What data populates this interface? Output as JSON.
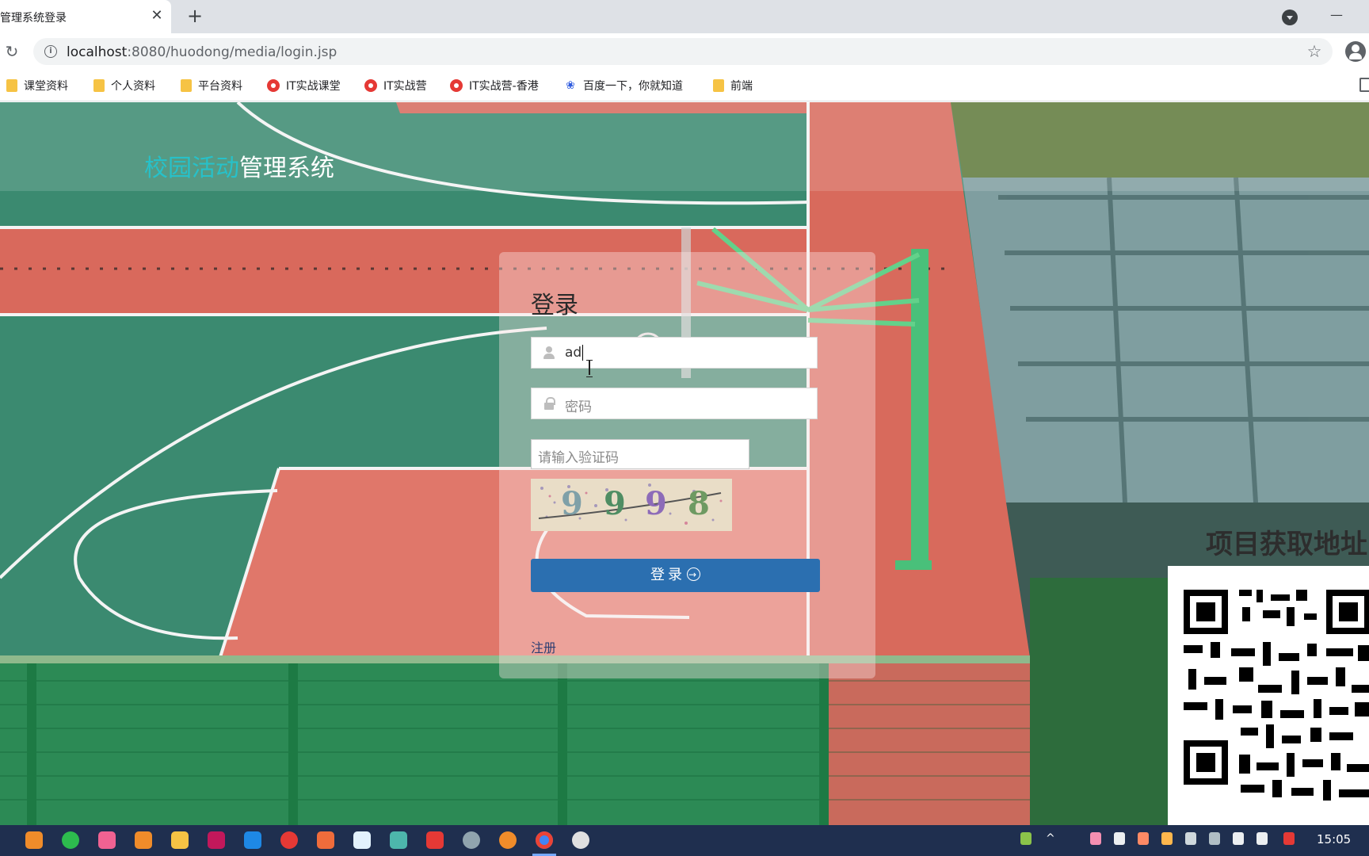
{
  "browser": {
    "tab_title": "管理系统登录",
    "tab_close": "✕",
    "new_tab": "+",
    "url_host": "localhost",
    "url_rest": ":8080/huodong/media/login.jsp",
    "reload": "↻",
    "star": "☆",
    "bookmarks": [
      {
        "label": "课堂资料",
        "icon": "folder-icon"
      },
      {
        "label": "个人资料",
        "icon": "folder-icon"
      },
      {
        "label": "平台资料",
        "icon": "folder-icon"
      },
      {
        "label": "IT实战课堂",
        "icon": "site-icon"
      },
      {
        "label": "IT实战营",
        "icon": "site-icon"
      },
      {
        "label": "IT实战营-香港",
        "icon": "site-icon"
      },
      {
        "label": "百度一下，你就知道",
        "icon": "paw-icon"
      },
      {
        "label": "前端",
        "icon": "folder-icon"
      }
    ]
  },
  "site": {
    "title_accent": "校园活动",
    "title_rest": "管理系统"
  },
  "login": {
    "heading": "登录",
    "username_value": "ad",
    "password_placeholder": "密码",
    "captcha_placeholder": "请输入验证码",
    "captcha_chars": [
      "9",
      "9",
      "9",
      "8"
    ],
    "button_label": "登录",
    "register_label": "注册"
  },
  "promo": {
    "title": "项目获取地址"
  },
  "taskbar": {
    "time": "15:05"
  },
  "colors": {
    "accent": "#27c1c9",
    "button": "#2b6fb0",
    "link": "#2c3e72"
  }
}
